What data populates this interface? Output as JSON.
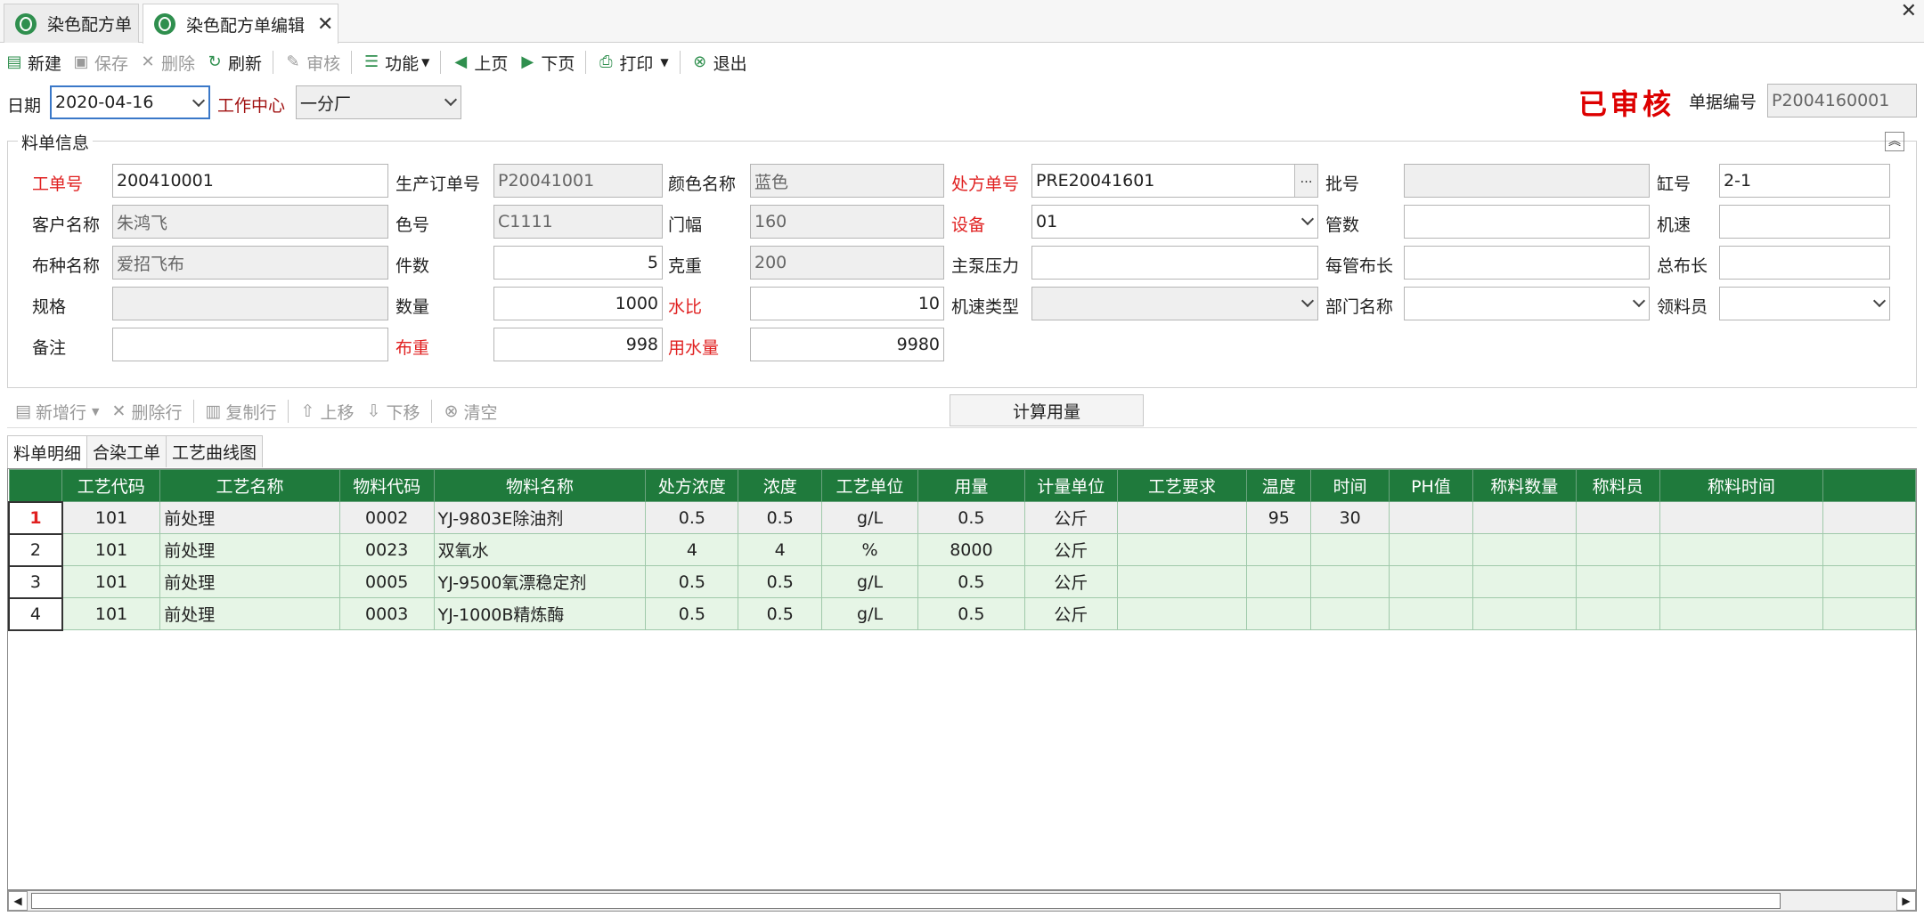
{
  "tabs": [
    {
      "label": "染色配方单"
    },
    {
      "label": "染色配方单编辑"
    }
  ],
  "toolbar": {
    "new": "新建",
    "save": "保存",
    "delete": "删除",
    "refresh": "刷新",
    "audit": "审核",
    "function": "功能",
    "prev": "上页",
    "next": "下页",
    "print": "打印",
    "exit": "退出"
  },
  "header": {
    "date_label": "日期",
    "date_value": "2020-04-16",
    "workcenter_label": "工作中心",
    "workcenter_value": "一分厂",
    "status_stamp": "已审核",
    "docno_label": "单据编号",
    "docno_value": "P2004160001"
  },
  "group_title": "料单信息",
  "form": {
    "job_no_label": "工单号",
    "job_no": "200410001",
    "prod_order_label": "生产订单号",
    "prod_order": "P20041001",
    "color_name_label": "颜色名称",
    "color_name": "蓝色",
    "recipe_no_label": "处方单号",
    "recipe_no": "PRE20041601",
    "batch_label": "批号",
    "batch": "",
    "vat_label": "缸号",
    "vat": "2-1",
    "customer_label": "客户名称",
    "customer": "朱鸿飞",
    "color_no_label": "色号",
    "color_no": "C1111",
    "width_label": "门幅",
    "width": "160",
    "equipment_label": "设备",
    "equipment": "01",
    "tubes_label": "管数",
    "tubes": "",
    "speed_label": "机速",
    "speed": "",
    "fabric_label": "布种名称",
    "fabric": "爱招飞布",
    "pieces_label": "件数",
    "pieces": "5",
    "gsm_label": "克重",
    "gsm": "200",
    "pump_label": "主泵压力",
    "pump": "",
    "tube_len_label": "每管布长",
    "tube_len": "",
    "total_len_label": "总布长",
    "total_len": "",
    "spec_label": "规格",
    "spec": "",
    "qty_label": "数量",
    "qty": "1000",
    "liquor_ratio_label": "水比",
    "liquor_ratio": "10",
    "speed_type_label": "机速类型",
    "speed_type": "",
    "dept_label": "部门名称",
    "dept": "",
    "picker_label": "领料员",
    "picker": "",
    "remark_label": "备注",
    "remark": "",
    "cloth_weight_label": "布重",
    "cloth_weight": "998",
    "water_label": "用水量",
    "water": "9980"
  },
  "line_toolbar": {
    "add": "新增行",
    "del": "删除行",
    "copy": "复制行",
    "up": "上移",
    "down": "下移",
    "clear": "清空"
  },
  "calc_button": "计算用量",
  "subtabs": [
    {
      "label": "料单明细"
    },
    {
      "label": "合染工单"
    },
    {
      "label": "工艺曲线图"
    }
  ],
  "grid": {
    "columns": [
      "工艺代码",
      "工艺名称",
      "物料代码",
      "物料名称",
      "处方浓度",
      "浓度",
      "工艺单位",
      "用量",
      "计量单位",
      "工艺要求",
      "温度",
      "时间",
      "PH值",
      "称料数量",
      "称料员",
      "称料时间"
    ],
    "rows": [
      {
        "n": "1",
        "c": [
          "101",
          "前处理",
          "0002",
          "YJ-9803E除油剂",
          "0.5",
          "0.5",
          "g/L",
          "0.5",
          "公斤",
          "",
          "95",
          "30",
          "",
          "",
          "",
          ""
        ]
      },
      {
        "n": "2",
        "c": [
          "101",
          "前处理",
          "0023",
          "双氧水",
          "4",
          "4",
          "%",
          "8000",
          "公斤",
          "",
          "",
          "",
          "",
          "",
          "",
          ""
        ]
      },
      {
        "n": "3",
        "c": [
          "101",
          "前处理",
          "0005",
          "YJ-9500氧漂稳定剂",
          "0.5",
          "0.5",
          "g/L",
          "0.5",
          "公斤",
          "",
          "",
          "",
          "",
          "",
          "",
          ""
        ]
      },
      {
        "n": "4",
        "c": [
          "101",
          "前处理",
          "0003",
          "YJ-1000B精炼酶",
          "0.5",
          "0.5",
          "g/L",
          "0.5",
          "公斤",
          "",
          "",
          "",
          "",
          "",
          "",
          ""
        ]
      }
    ]
  },
  "colors": {
    "header_green": "#1f7a3c",
    "row_green": "#e6f5e6",
    "required_red": "#e02020"
  }
}
